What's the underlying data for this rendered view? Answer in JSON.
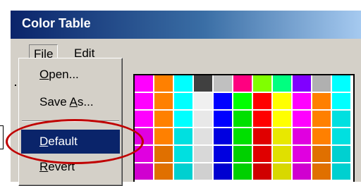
{
  "window": {
    "title": "Color Table"
  },
  "menubar": {
    "items": [
      {
        "label": "File",
        "mnemonic": "F",
        "rest": "ile",
        "open": true
      },
      {
        "label": "Edit",
        "mnemonic": "E",
        "rest": "dit",
        "open": false
      }
    ]
  },
  "file_menu": {
    "items": [
      {
        "label": "Open...",
        "pre": "",
        "mnemonic": "O",
        "post": "pen...",
        "selected": false
      },
      {
        "label": "Save As...",
        "pre": "Save ",
        "mnemonic": "A",
        "post": "s...",
        "selected": false
      },
      {
        "label": "Default",
        "pre": "",
        "mnemonic": "D",
        "post": "efault",
        "selected": true
      },
      {
        "label": "Revert",
        "pre": "",
        "mnemonic": "R",
        "post": "evert",
        "selected": false
      }
    ]
  },
  "annotation": {
    "type": "ellipse",
    "target": "Default",
    "color": "#c00000"
  },
  "color_grid": {
    "columns": 11,
    "rows": [
      [
        "#ff00ff",
        "#ff8000",
        "#00ffff",
        "#404040",
        "#c0c0c0",
        "#ff0080",
        "#80ff00",
        "#00ff80",
        "#8000ff",
        "#b0b0b0",
        "#00ffff"
      ],
      [
        "#ff00ff",
        "#ff8000",
        "#00ffff",
        "#f0f0f0",
        "#0000ff",
        "#00ff00",
        "#ff0000",
        "#ffff00",
        "#ff00ff",
        "#ff8000",
        "#00ffff"
      ],
      [
        "#ff00ff",
        "#ff8000",
        "#00ffff",
        "#e8e8e8",
        "#0000ff",
        "#00e000",
        "#ff0000",
        "#ffff00",
        "#ff00ff",
        "#ff8000",
        "#00e0e0"
      ],
      [
        "#e000e0",
        "#ff8000",
        "#00e0e0",
        "#e0e0e0",
        "#0000e0",
        "#00e000",
        "#e00000",
        "#e8e800",
        "#e000e0",
        "#ff8000",
        "#00e0e0"
      ],
      [
        "#e000e0",
        "#e07000",
        "#00e0e0",
        "#d8d8d8",
        "#0000e0",
        "#00d000",
        "#e00000",
        "#e0e000",
        "#e000e0",
        "#e07000",
        "#00d0d0"
      ],
      [
        "#d000d0",
        "#e07000",
        "#00d0d0",
        "#d0d0d0",
        "#0000d0",
        "#00d000",
        "#d00000",
        "#d8d800",
        "#d000d0",
        "#e07000",
        "#00d0d0"
      ]
    ]
  }
}
